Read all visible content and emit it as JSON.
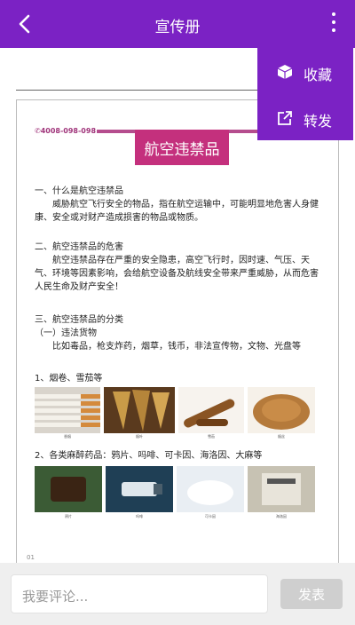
{
  "header": {
    "title": "宣传册"
  },
  "menu": {
    "items": [
      {
        "label": "收藏",
        "icon": "cube-icon"
      },
      {
        "label": "转发",
        "icon": "share-icon"
      }
    ]
  },
  "document": {
    "phone": "✆4008-098-098",
    "banner": "航空违禁品",
    "sec1_title": "一、什么是航空违禁品",
    "sec1_body": "威胁航空飞行安全的物品，指在航空运输中，可能明显地危害人身健康、安全或对财产造成损害的物品或物质。",
    "sec2_title": "二、航空违禁品的危害",
    "sec2_body": "航空违禁品存在严重的安全隐患，高空飞行时，因时速、气压、天气、环境等因素影响，会给航空设备及航线安全带来严重威胁，从而危害人民生命及财产安全！",
    "sec3_title": "三、航空违禁品的分类",
    "sec3_sub": "（一）违法货物",
    "sec3_body": "比如毒品，枪支炸药，烟草，钱币，非法宣传物，文物、光盘等",
    "list1": "1、烟卷、雪茄等",
    "list1_captions": [
      "香烟",
      "烟叶",
      "雪茄",
      "烟丝"
    ],
    "list2": "2、各类麻醉药品：鸦片、吗啡、可卡因、海洛因、大麻等",
    "list2_captions": [
      "鸦片",
      "吗啡",
      "可卡因",
      "海洛因"
    ],
    "page_mark": "01"
  },
  "comment": {
    "placeholder": "我要评论...",
    "send_label": "发表"
  },
  "colors": {
    "accent": "#7b22c4",
    "banner": "#c4307d"
  }
}
